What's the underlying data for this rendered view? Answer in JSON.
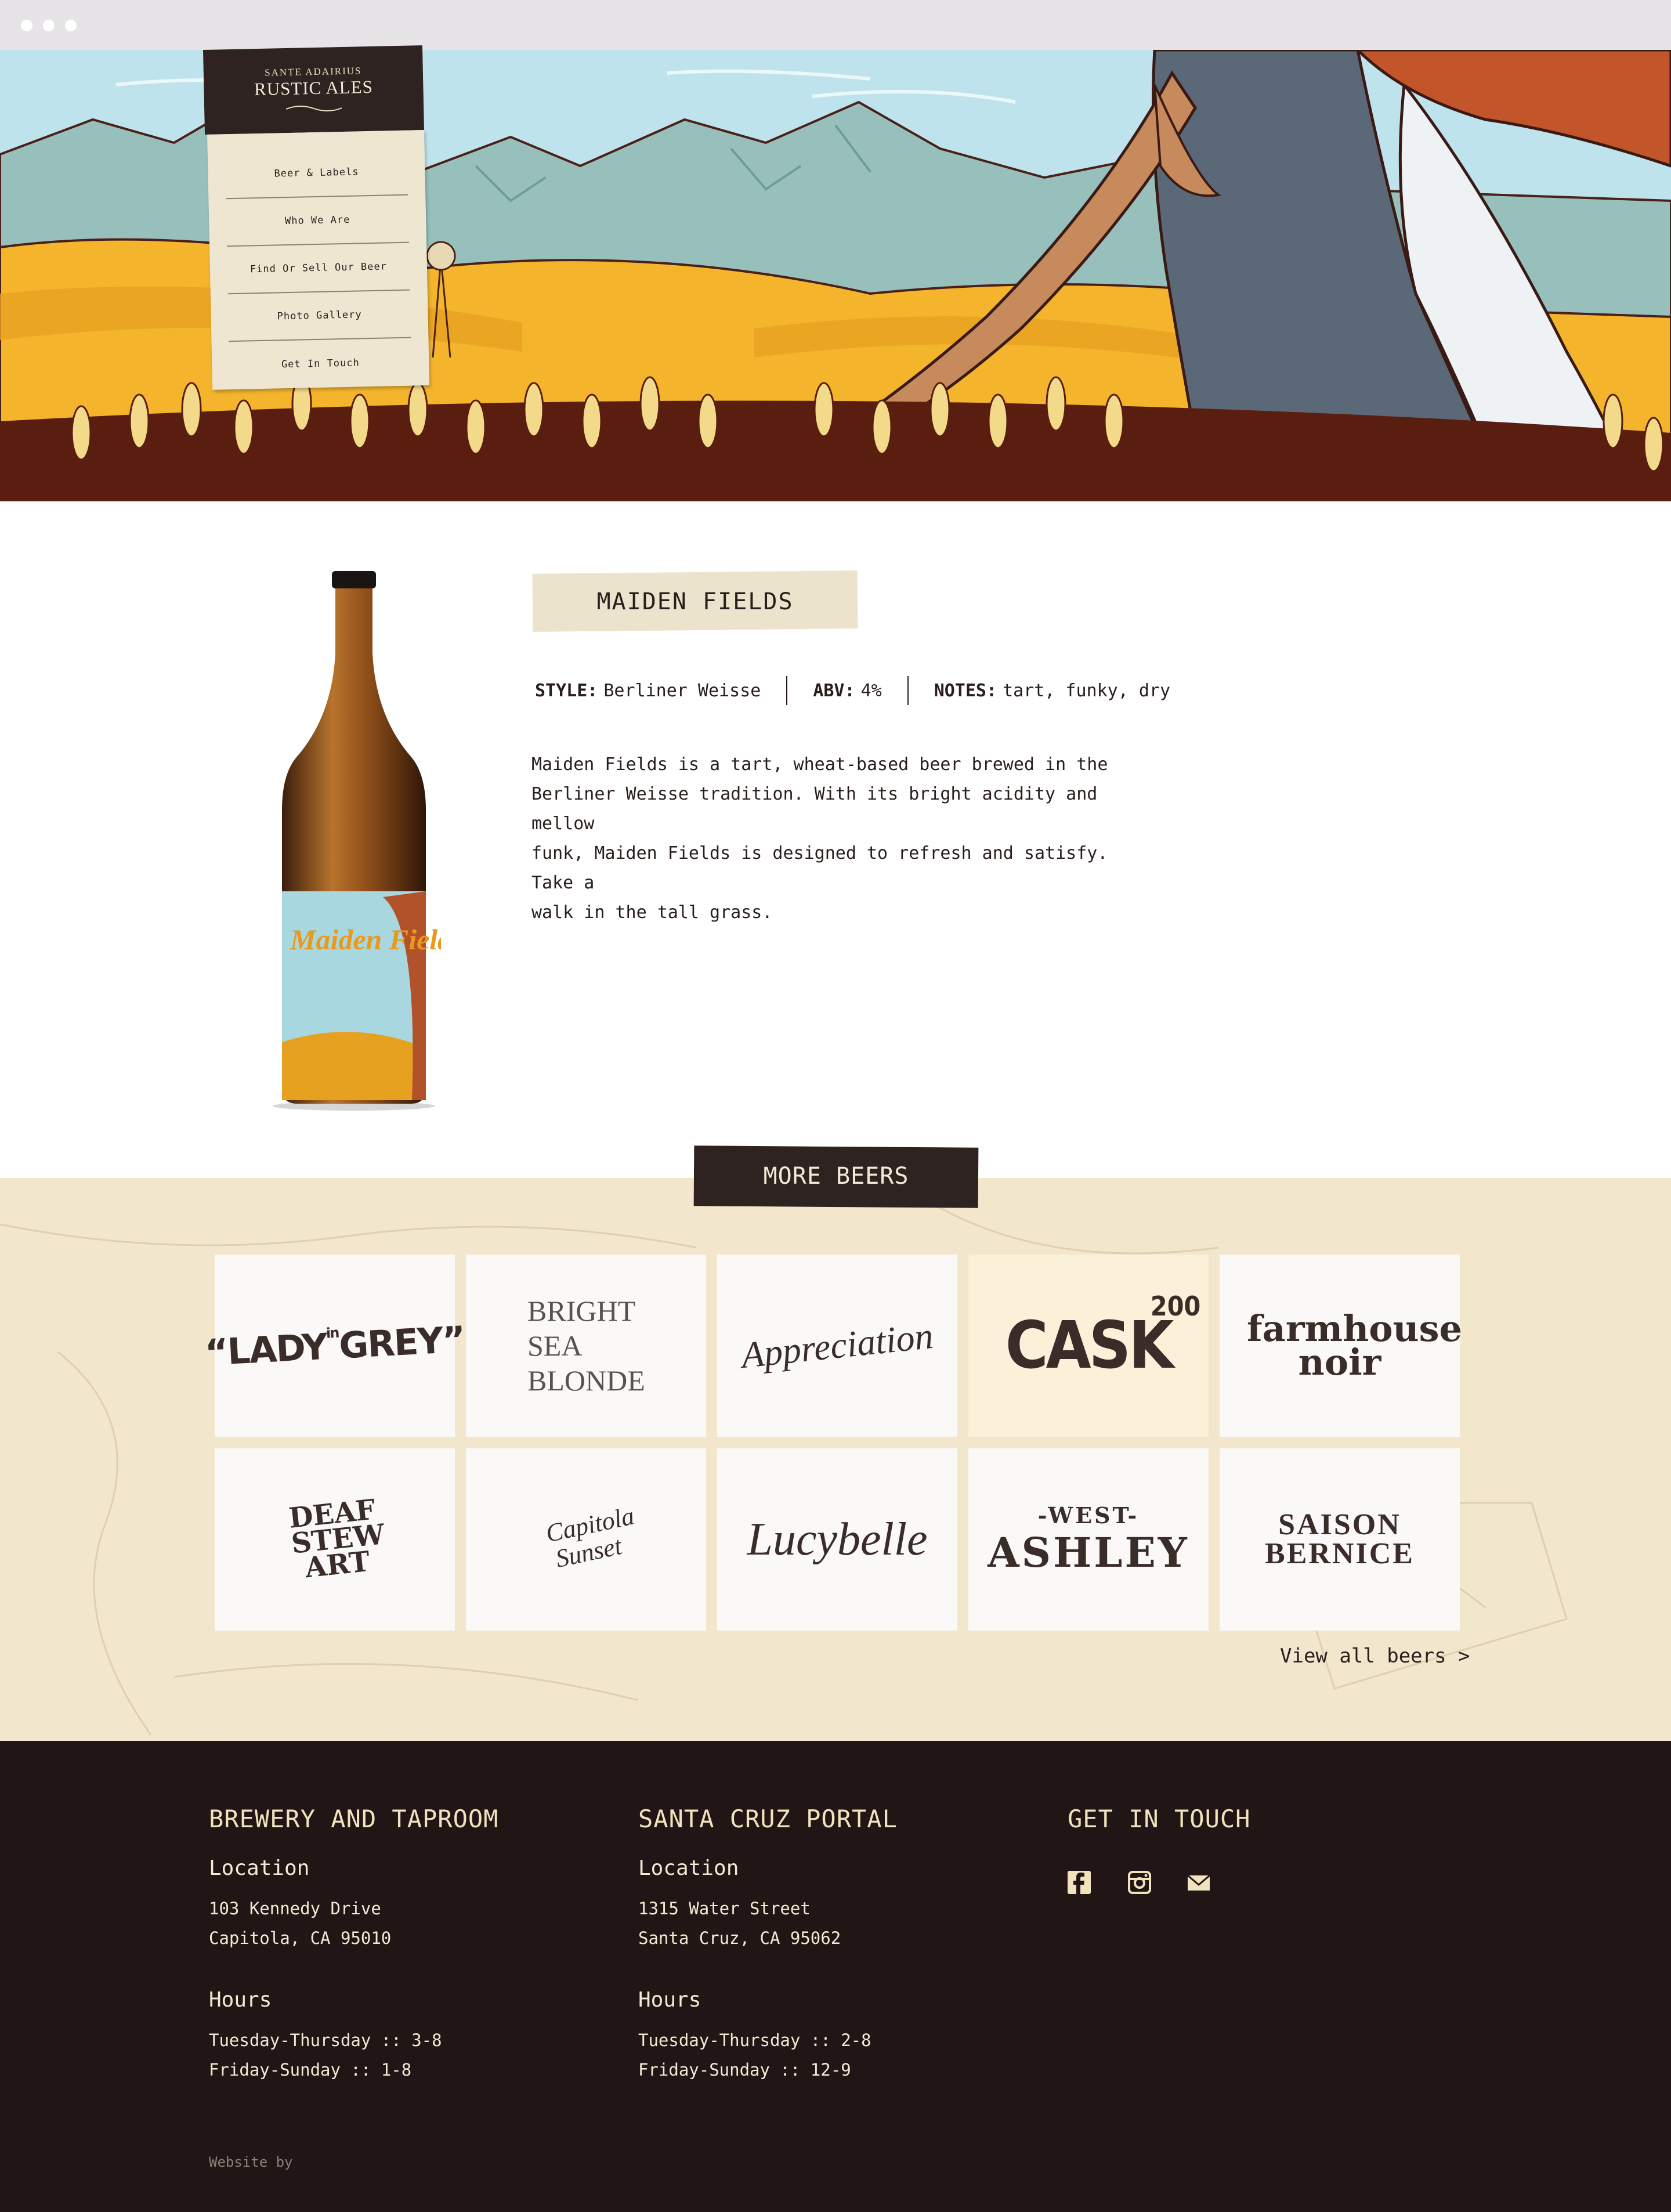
{
  "brand": {
    "small": "SANTE ADAIRIUS",
    "big": "RUSTIC ALES"
  },
  "nav": {
    "items": [
      "Beer & Labels",
      "Who We Are",
      "Find Or Sell Our Beer",
      "Photo Gallery",
      "Get In Touch"
    ]
  },
  "beer": {
    "name": "MAIDEN FIELDS",
    "label_art": "Maiden Fields",
    "specs": [
      {
        "label": "STYLE:",
        "value": "Berliner Weisse"
      },
      {
        "label": "ABV:",
        "value": "4%"
      },
      {
        "label": "NOTES:",
        "value": "tart, funky, dry"
      }
    ],
    "description_lines": [
      "Maiden Fields is a tart, wheat-based beer brewed in the",
      "Berliner Weisse tradition. With its bright acidity and mellow",
      "funk, Maiden Fields is designed to refresh and satisfy. Take a",
      "walk in the tall grass."
    ]
  },
  "more_beers": {
    "button": "MORE BEERS",
    "view_all": "View all beers >",
    "tiles": [
      {
        "pre": "“LADY",
        "small": "in",
        "post": "GREY”"
      },
      {
        "text": "BRIGHT SEA BLONDE"
      },
      {
        "text": "Appreciation"
      },
      {
        "text": "CASK",
        "sup": "200"
      },
      {
        "text": "farmhouse noir"
      },
      {
        "text": "DEAF STEW ART"
      },
      {
        "text": "Capitola Sunset"
      },
      {
        "text": "Lucybelle"
      },
      {
        "top": "-WEST-",
        "text": "ASHLEY"
      },
      {
        "text": "SAISON BERNICE"
      }
    ]
  },
  "footer": {
    "columns": [
      {
        "title": "BREWERY AND TAPROOM",
        "location_label": "Location",
        "address": [
          "103 Kennedy Drive",
          "Capitola, CA 95010"
        ],
        "hours_label": "Hours",
        "hours": [
          "Tuesday-Thursday :: 3-8",
          "Friday-Sunday :: 1-8"
        ]
      },
      {
        "title": "SANTA CRUZ PORTAL",
        "location_label": "Location",
        "address": [
          "1315 Water Street",
          "Santa Cruz, CA 95062"
        ],
        "hours_label": "Hours",
        "hours": [
          "Tuesday-Thursday :: 2-8",
          "Friday-Sunday :: 12-9"
        ]
      }
    ],
    "contact_title": "GET IN TOUCH",
    "social_icons": [
      "facebook-icon",
      "instagram-icon",
      "mail-icon"
    ],
    "credit": "Website by"
  },
  "colors": {
    "dark": "#211615",
    "paper": "#f2e7cc",
    "wheat": "#f4b52d",
    "sky": "#bfe3ec"
  }
}
